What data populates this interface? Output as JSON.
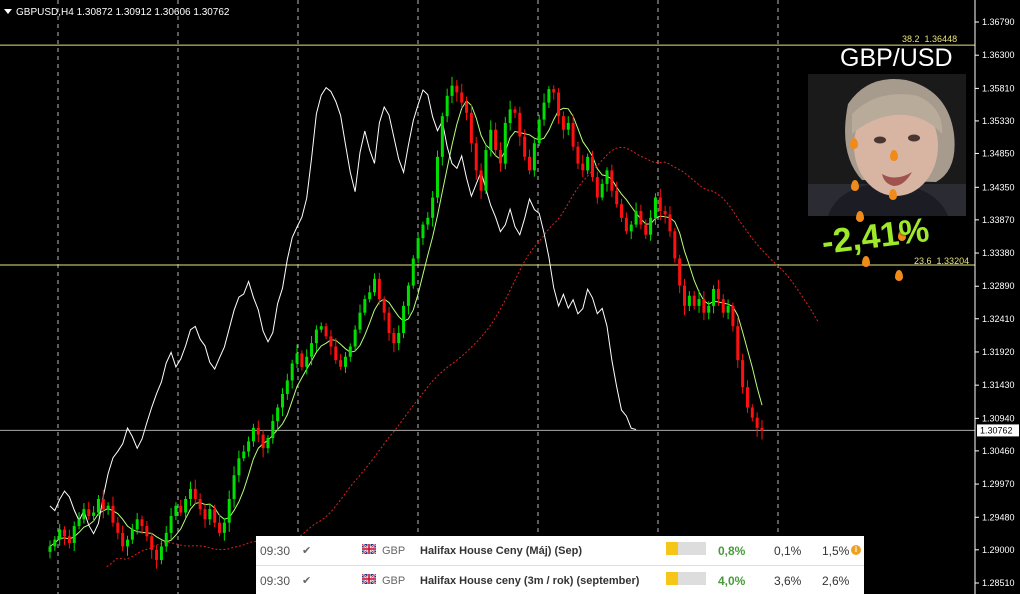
{
  "header": {
    "symbol_line": "GBPUSD,H4  1.30872  1.30912  1.30606  1.30762"
  },
  "overlay": {
    "title": "GBP/USD",
    "change": "-2,41%",
    "portrait_icon": "person-portrait-icon"
  },
  "levels": [
    {
      "label": "38.2",
      "price": "1.36448"
    },
    {
      "label": "23.6",
      "price": "1.33204"
    }
  ],
  "current_price": "1.30762",
  "calendar": {
    "rows": [
      {
        "time": "09:30",
        "currency": "GBP",
        "event": "Halifax House Ceny (Máj) (Sep)",
        "importance": 0.3,
        "actual": "0,8%",
        "forecast": "0,1%",
        "previous": "1,5%",
        "has_info": true
      },
      {
        "time": "09:30",
        "currency": "GBP",
        "event": "Halifax House ceny (3m / rok) (september)",
        "importance": 0.3,
        "actual": "4,0%",
        "forecast": "3,6%",
        "previous": "2,6%",
        "has_info": false
      }
    ]
  },
  "colors": {
    "bull_candle": "#00e000",
    "bear_candle": "#ff1010",
    "accent_green": "#9eea2a",
    "level_line": "#e8e37a",
    "drop": "#f08b1a"
  },
  "chart_data": {
    "type": "candlestick",
    "title": "",
    "symbol": "GBPUSD",
    "timeframe": "H4",
    "ohlc_header": {
      "open": 1.30872,
      "high": 1.30912,
      "low": 1.30606,
      "close": 1.30762
    },
    "y_ticks": [
      "1.36790",
      "1.36300",
      "1.35810",
      "1.35330",
      "1.34850",
      "1.34350",
      "1.33870",
      "1.33380",
      "1.32890",
      "1.32410",
      "1.31920",
      "1.31430",
      "1.30940",
      "1.30460",
      "1.29970",
      "1.29480",
      "1.29000",
      "1.28510"
    ],
    "ylim": [
      1.283,
      1.3705
    ],
    "horizontal_levels": [
      {
        "name": "38.2",
        "value": 1.36448
      },
      {
        "name": "23.6",
        "value": 1.33204
      },
      {
        "name": "current",
        "value": 1.30762
      }
    ],
    "grid": "vertical dashed",
    "closes": [
      1.2905,
      1.2915,
      1.293,
      1.292,
      1.291,
      1.2935,
      1.2945,
      1.296,
      1.295,
      1.2955,
      1.2975,
      1.296,
      1.2965,
      1.294,
      1.2925,
      1.2905,
      1.2915,
      1.293,
      1.2945,
      1.2935,
      1.292,
      1.29,
      1.2885,
      1.2905,
      1.2925,
      1.295,
      1.2965,
      1.2955,
      1.2975,
      1.299,
      1.2975,
      1.296,
      1.2945,
      1.296,
      1.294,
      1.2925,
      1.294,
      1.2975,
      1.301,
      1.3035,
      1.3045,
      1.306,
      1.308,
      1.307,
      1.305,
      1.3065,
      1.309,
      1.311,
      1.313,
      1.315,
      1.3175,
      1.319,
      1.317,
      1.3185,
      1.3205,
      1.3225,
      1.323,
      1.3215,
      1.32,
      1.318,
      1.317,
      1.3185,
      1.32,
      1.3225,
      1.325,
      1.327,
      1.328,
      1.33,
      1.327,
      1.325,
      1.322,
      1.3205,
      1.322,
      1.326,
      1.329,
      1.333,
      1.336,
      1.338,
      1.339,
      1.342,
      1.348,
      1.354,
      1.357,
      1.3585,
      1.3575,
      1.356,
      1.3545,
      1.35,
      1.346,
      1.343,
      1.349,
      1.352,
      1.349,
      1.347,
      1.353,
      1.355,
      1.3545,
      1.351,
      1.348,
      1.346,
      1.35,
      1.3535,
      1.356,
      1.358,
      1.3575,
      1.354,
      1.352,
      1.353,
      1.3495,
      1.347,
      1.346,
      1.348,
      1.345,
      1.342,
      1.344,
      1.346,
      1.343,
      1.341,
      1.339,
      1.337,
      1.338,
      1.34,
      1.338,
      1.3365,
      1.339,
      1.342,
      1.34,
      1.3395,
      1.337,
      1.333,
      1.329,
      1.326,
      1.3275,
      1.326,
      1.327,
      1.325,
      1.326,
      1.3285,
      1.327,
      1.325,
      1.326,
      1.323,
      1.318,
      1.314,
      1.311,
      1.3095,
      1.308,
      1.3076
    ]
  }
}
